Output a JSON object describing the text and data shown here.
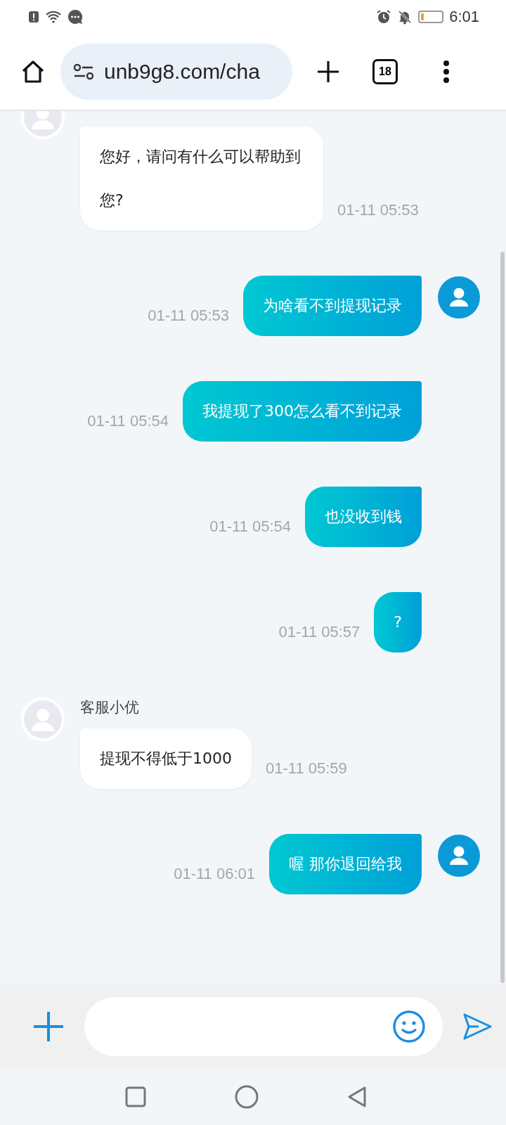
{
  "status_bar": {
    "time": "6:01"
  },
  "browser": {
    "url": "unb9g8.com/cha",
    "tab_count": "18"
  },
  "messages": [
    {
      "kind": "agent",
      "avatar": true,
      "text": "您好，请问有什么可以帮助到您?",
      "time": "01-11 05:53"
    },
    {
      "kind": "user",
      "avatar": true,
      "text": "为啥看不到提现记录",
      "time": "01-11 05:53"
    },
    {
      "kind": "user",
      "avatar": false,
      "text": "我提现了300怎么看不到记录",
      "time": "01-11 05:54"
    },
    {
      "kind": "user",
      "avatar": false,
      "text": "也没收到钱",
      "time": "01-11 05:54"
    },
    {
      "kind": "user",
      "avatar": false,
      "text": "?",
      "time": "01-11 05:57"
    },
    {
      "kind": "agent",
      "avatar": true,
      "sender": "客服小优",
      "text": "提现不得低于1000",
      "time": "01-11 05:59"
    },
    {
      "kind": "user",
      "avatar": true,
      "text": "喔 那你退回给我",
      "time": "01-11 06:01"
    }
  ]
}
